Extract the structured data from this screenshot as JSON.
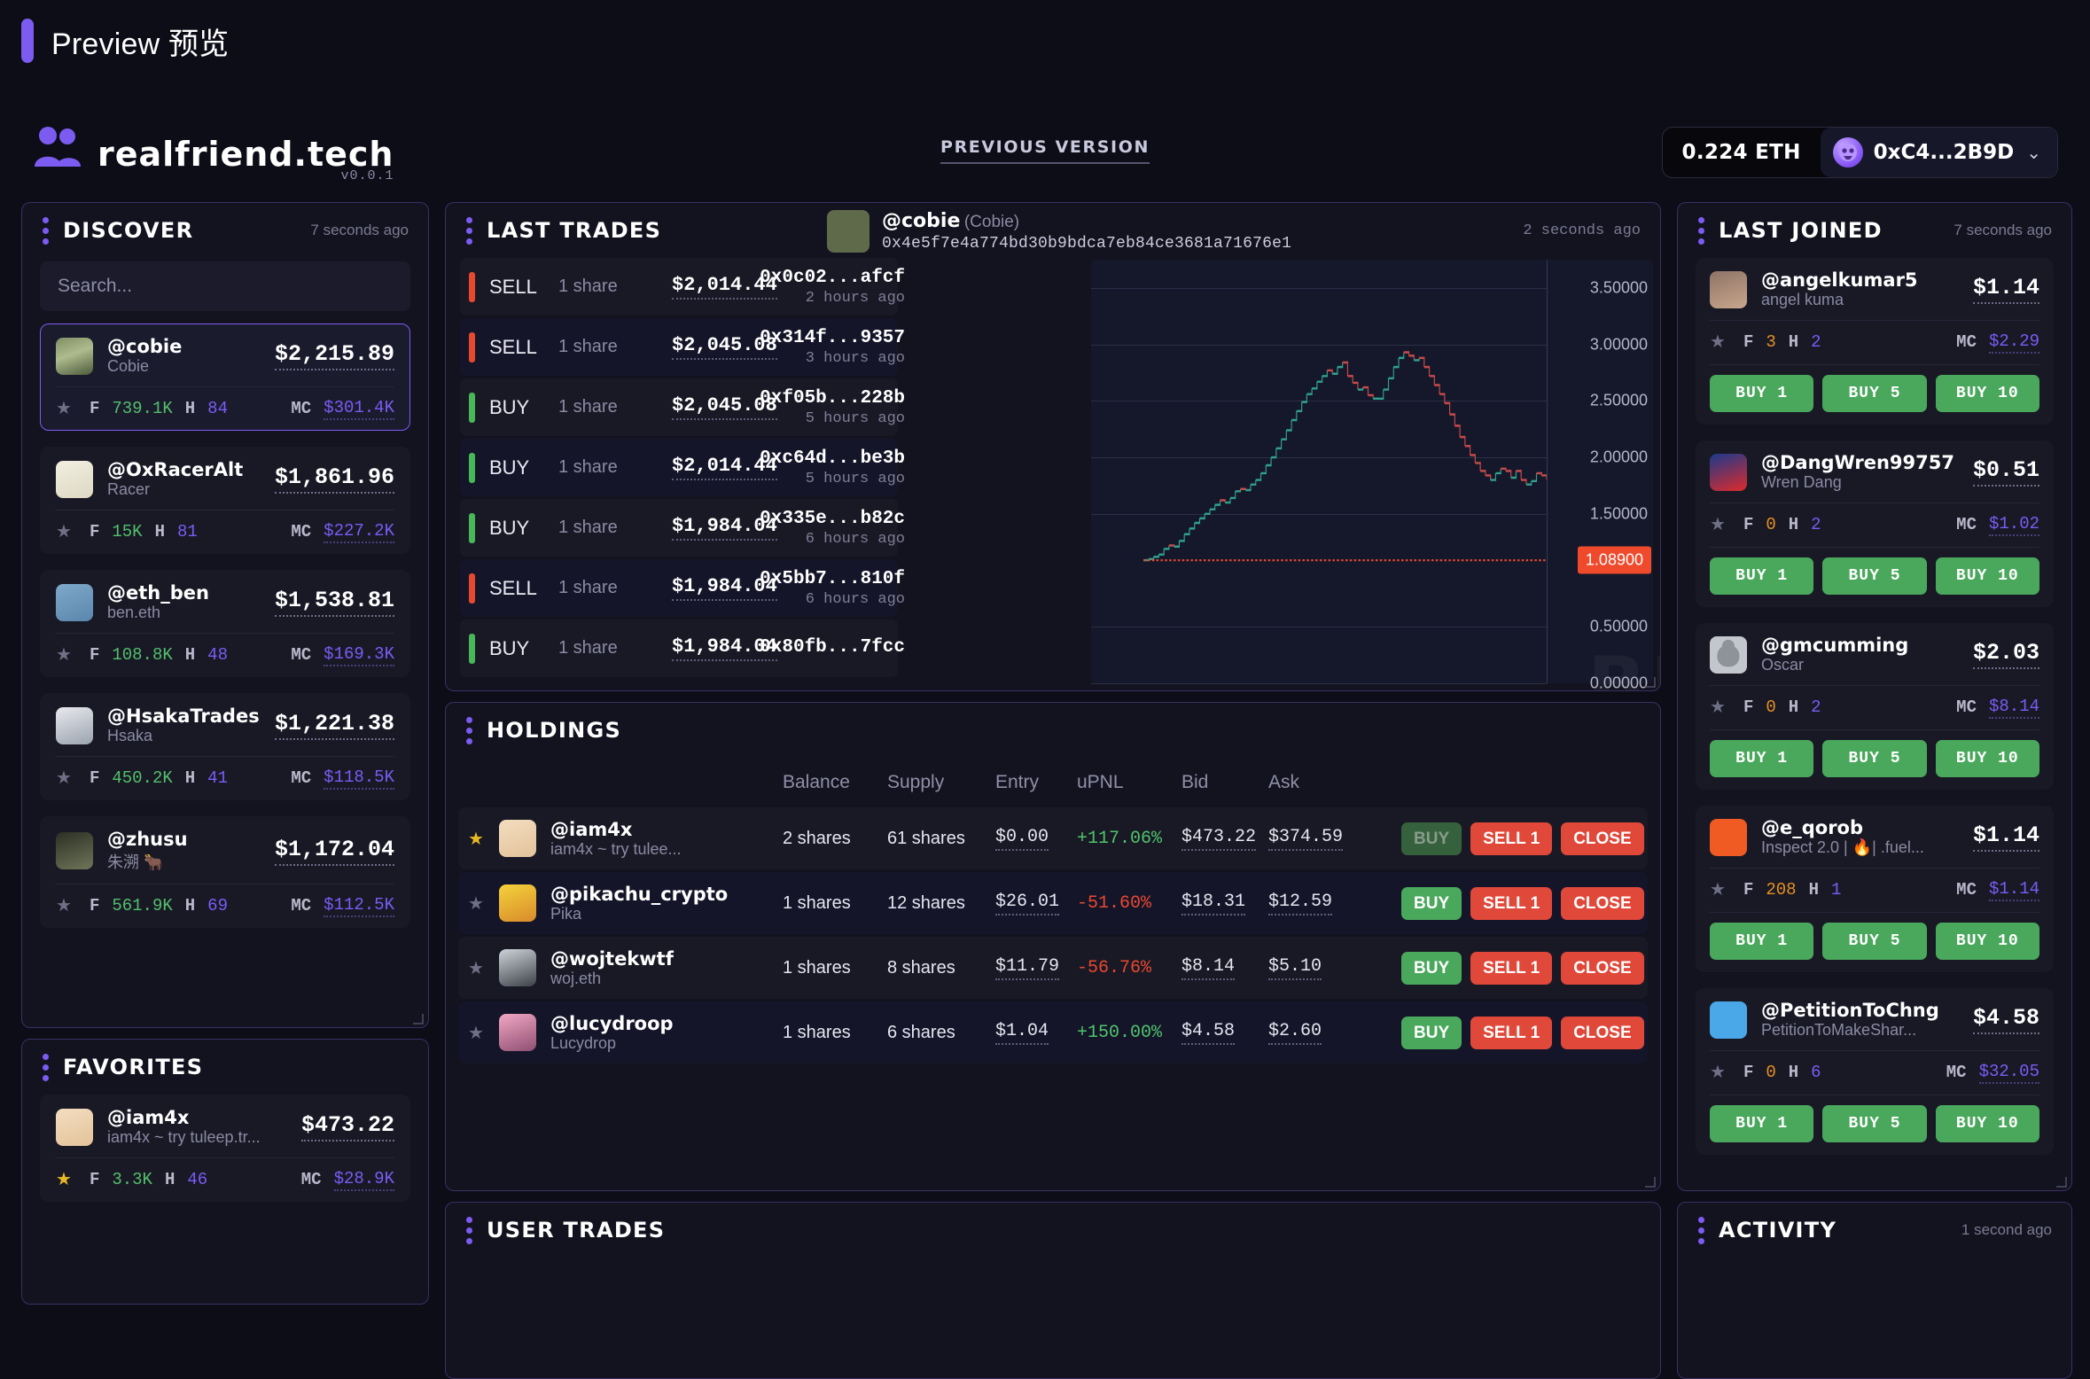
{
  "preview": {
    "label": "Preview 预览"
  },
  "header": {
    "brand_name": "realfriend.tech",
    "version": "v0.0.1",
    "previous_version_link": "PREVIOUS VERSION",
    "wallet_balance": "0.224 ETH",
    "wallet_address": "0xC4...2B9D",
    "wallet_caret": "⌄"
  },
  "discover": {
    "title": "DISCOVER",
    "time": "7 seconds ago",
    "search_placeholder": "Search...",
    "search_value": "",
    "labels": {
      "f": "F",
      "h": "H",
      "mc": "MC",
      "star": "★"
    },
    "items": [
      {
        "handle": "@cobie",
        "sub": "Cobie",
        "price": "$2,215.89",
        "f": "739.1K",
        "h": "84",
        "mc": "$301.4K",
        "selected": true,
        "fav": false,
        "avatar": "av-cobie"
      },
      {
        "handle": "@OxRacerAlt",
        "sub": "Racer",
        "price": "$1,861.96",
        "f": "15K",
        "h": "81",
        "mc": "$227.2K",
        "selected": false,
        "fav": false,
        "avatar": "av-racer"
      },
      {
        "handle": "@eth_ben",
        "sub": "ben.eth",
        "price": "$1,538.81",
        "f": "108.8K",
        "h": "48",
        "mc": "$169.3K",
        "selected": false,
        "fav": false,
        "avatar": "av-ben"
      },
      {
        "handle": "@HsakaTrades",
        "sub": "Hsaka",
        "price": "$1,221.38",
        "f": "450.2K",
        "h": "41",
        "mc": "$118.5K",
        "selected": false,
        "fav": false,
        "avatar": "av-hsaka"
      },
      {
        "handle": "@zhusu",
        "sub": "朱溯 🐂",
        "price": "$1,172.04",
        "f": "561.9K",
        "h": "69",
        "mc": "$112.5K",
        "selected": false,
        "fav": false,
        "avatar": "av-zhusu"
      }
    ]
  },
  "favorites": {
    "title": "FAVORITES",
    "items": [
      {
        "handle": "@iam4x",
        "sub": "iam4x ~ try tuleep.tr...",
        "price": "$473.22",
        "f": "3.3K",
        "h": "46",
        "mc": "$28.9K",
        "fav": true,
        "avatar": "av-iam4x"
      }
    ]
  },
  "last_trades": {
    "title": "LAST TRADES",
    "time": "2  seconds  ago",
    "subject": {
      "handle": "@cobie",
      "realname": "(Cobie)",
      "address": "0x4e5f7e4a774bd30b9bdca7eb84ce3681a71676e1"
    },
    "rows": [
      {
        "side": "SELL",
        "qty": "1 share",
        "price": "$2,014.44",
        "hash": "0x0c02...afcf",
        "ago": "2 hours ago"
      },
      {
        "side": "SELL",
        "qty": "1 share",
        "price": "$2,045.08",
        "hash": "0x314f...9357",
        "ago": "3 hours ago"
      },
      {
        "side": "BUY",
        "qty": "1 share",
        "price": "$2,045.08",
        "hash": "0xf05b...228b",
        "ago": "5 hours ago"
      },
      {
        "side": "BUY",
        "qty": "1 share",
        "price": "$2,014.44",
        "hash": "0xc64d...be3b",
        "ago": "5 hours ago"
      },
      {
        "side": "BUY",
        "qty": "1 share",
        "price": "$1,984.04",
        "hash": "0x335e...b82c",
        "ago": "6 hours ago"
      },
      {
        "side": "SELL",
        "qty": "1 share",
        "price": "$1,984.04",
        "hash": "0x5bb7...810f",
        "ago": "6 hours ago"
      },
      {
        "side": "BUY",
        "qty": "1 share",
        "price": "$1,984.04",
        "hash": "0x80fb...7fcc",
        "ago": ""
      }
    ],
    "watermark": "BLOCKBEATS"
  },
  "chart_data": {
    "type": "line",
    "title": "",
    "xlabel": "",
    "ylabel": "",
    "ylim": [
      0,
      3.75
    ],
    "grid": true,
    "legend": null,
    "yticks": [
      "3.50000",
      "3.00000",
      "2.50000",
      "2.00000",
      "1.50000",
      "0.50000",
      "0.00000"
    ],
    "ytick_values": [
      3.5,
      3.0,
      2.5,
      2.0,
      1.5,
      0.5,
      0.0
    ],
    "last_price_label": "1.08900",
    "last_price_value": 1.089,
    "reference_line": {
      "value": 1.089,
      "style": "dotted",
      "color": "#ef4a2c"
    },
    "series": [
      {
        "name": "price",
        "up_color": "#2fa18c",
        "down_color": "#c94a4a",
        "values": [
          1.09,
          1.1,
          1.12,
          1.14,
          1.19,
          1.22,
          1.21,
          1.26,
          1.32,
          1.37,
          1.42,
          1.46,
          1.5,
          1.54,
          1.58,
          1.62,
          1.6,
          1.64,
          1.7,
          1.72,
          1.71,
          1.76,
          1.8,
          1.86,
          1.93,
          2.0,
          2.08,
          2.16,
          2.24,
          2.33,
          2.41,
          2.49,
          2.56,
          2.61,
          2.67,
          2.72,
          2.77,
          2.74,
          2.8,
          2.84,
          2.72,
          2.66,
          2.6,
          2.62,
          2.55,
          2.52,
          2.52,
          2.6,
          2.7,
          2.8,
          2.88,
          2.93,
          2.9,
          2.86,
          2.88,
          2.8,
          2.72,
          2.64,
          2.56,
          2.48,
          2.38,
          2.28,
          2.18,
          2.1,
          2.02,
          1.95,
          1.88,
          1.84,
          1.8,
          1.86,
          1.9,
          1.88,
          1.82,
          1.88,
          1.8,
          1.76,
          1.79,
          1.86,
          1.84,
          1.8
        ]
      }
    ]
  },
  "holdings": {
    "title": "HOLDINGS",
    "columns": [
      "Balance",
      "Supply",
      "Entry",
      "uPNL",
      "Bid",
      "Ask"
    ],
    "rows": [
      {
        "handle": "@iam4x",
        "sub": "iam4x ~ try tulee...",
        "balance": "2 shares",
        "supply": "61 shares",
        "entry": "$0.00",
        "upnl": "+117.06%",
        "upnl_sign": "pos",
        "bid": "$473.22",
        "ask": "$374.59",
        "fav": true,
        "avatar": "av-iam4x",
        "buy_disabled": true
      },
      {
        "handle": "@pikachu_crypto",
        "sub": "Pika",
        "balance": "1 shares",
        "supply": "12 shares",
        "entry": "$26.01",
        "upnl": "-51.60%",
        "upnl_sign": "neg",
        "bid": "$18.31",
        "ask": "$12.59",
        "fav": false,
        "avatar": "av-pika",
        "buy_disabled": false
      },
      {
        "handle": "@wojtekwtf",
        "sub": "woj.eth",
        "balance": "1 shares",
        "supply": "8 shares",
        "entry": "$11.79",
        "upnl": "-56.76%",
        "upnl_sign": "neg",
        "bid": "$8.14",
        "ask": "$5.10",
        "fav": false,
        "avatar": "av-woj",
        "buy_disabled": false
      },
      {
        "handle": "@lucydroop",
        "sub": "Lucydrop",
        "balance": "1 shares",
        "supply": "6 shares",
        "entry": "$1.04",
        "upnl": "+150.00%",
        "upnl_sign": "pos",
        "bid": "$4.58",
        "ask": "$2.60",
        "fav": false,
        "avatar": "av-lucy",
        "buy_disabled": false
      }
    ],
    "actions": {
      "buy": "BUY",
      "sell": "SELL 1",
      "close": "CLOSE"
    }
  },
  "user_trades": {
    "title": "USER TRADES"
  },
  "last_joined": {
    "title": "LAST JOINED",
    "time": "7 seconds ago",
    "buy_labels": [
      "BUY 1",
      "BUY 5",
      "BUY 10"
    ],
    "items": [
      {
        "handle": "@angelkumar5",
        "sub": "angel kuma",
        "price": "$1.14",
        "f": "3",
        "h": "2",
        "mc": "$2.29",
        "avatar": "av-angel"
      },
      {
        "handle": "@DangWren99757",
        "sub": "Wren Dang",
        "price": "$0.51",
        "f": "0",
        "h": "2",
        "mc": "$1.02",
        "avatar": "av-wren"
      },
      {
        "handle": "@gmcumming",
        "sub": "Oscar",
        "price": "$2.03",
        "f": "0",
        "h": "2",
        "mc": "$8.14",
        "avatar": "av-oscar"
      },
      {
        "handle": "@e_qorob",
        "sub": "Inspect 2.0 | 🔥| .fuel...",
        "price": "$1.14",
        "f": "208",
        "h": "1",
        "mc": "$1.14",
        "avatar": "av-qorob"
      },
      {
        "handle": "@PetitionToChng",
        "sub": "PetitionToMakeShar...",
        "price": "$4.58",
        "f": "0",
        "h": "6",
        "mc": "$32.05",
        "avatar": "av-pet"
      }
    ]
  },
  "activity": {
    "title": "ACTIVITY",
    "time": "1 second ago"
  },
  "colors": {
    "accent": "#7c5cf0",
    "buy_green": "#4aa85c",
    "sell_red": "#e0483a",
    "followers_green": "#52c06a",
    "followers_orange": "#e8901f",
    "holders_purple": "#7a5cf5",
    "mc_purple": "#7a5cf5",
    "bg": "#0d0d18",
    "panel_bg": "#13131f"
  }
}
